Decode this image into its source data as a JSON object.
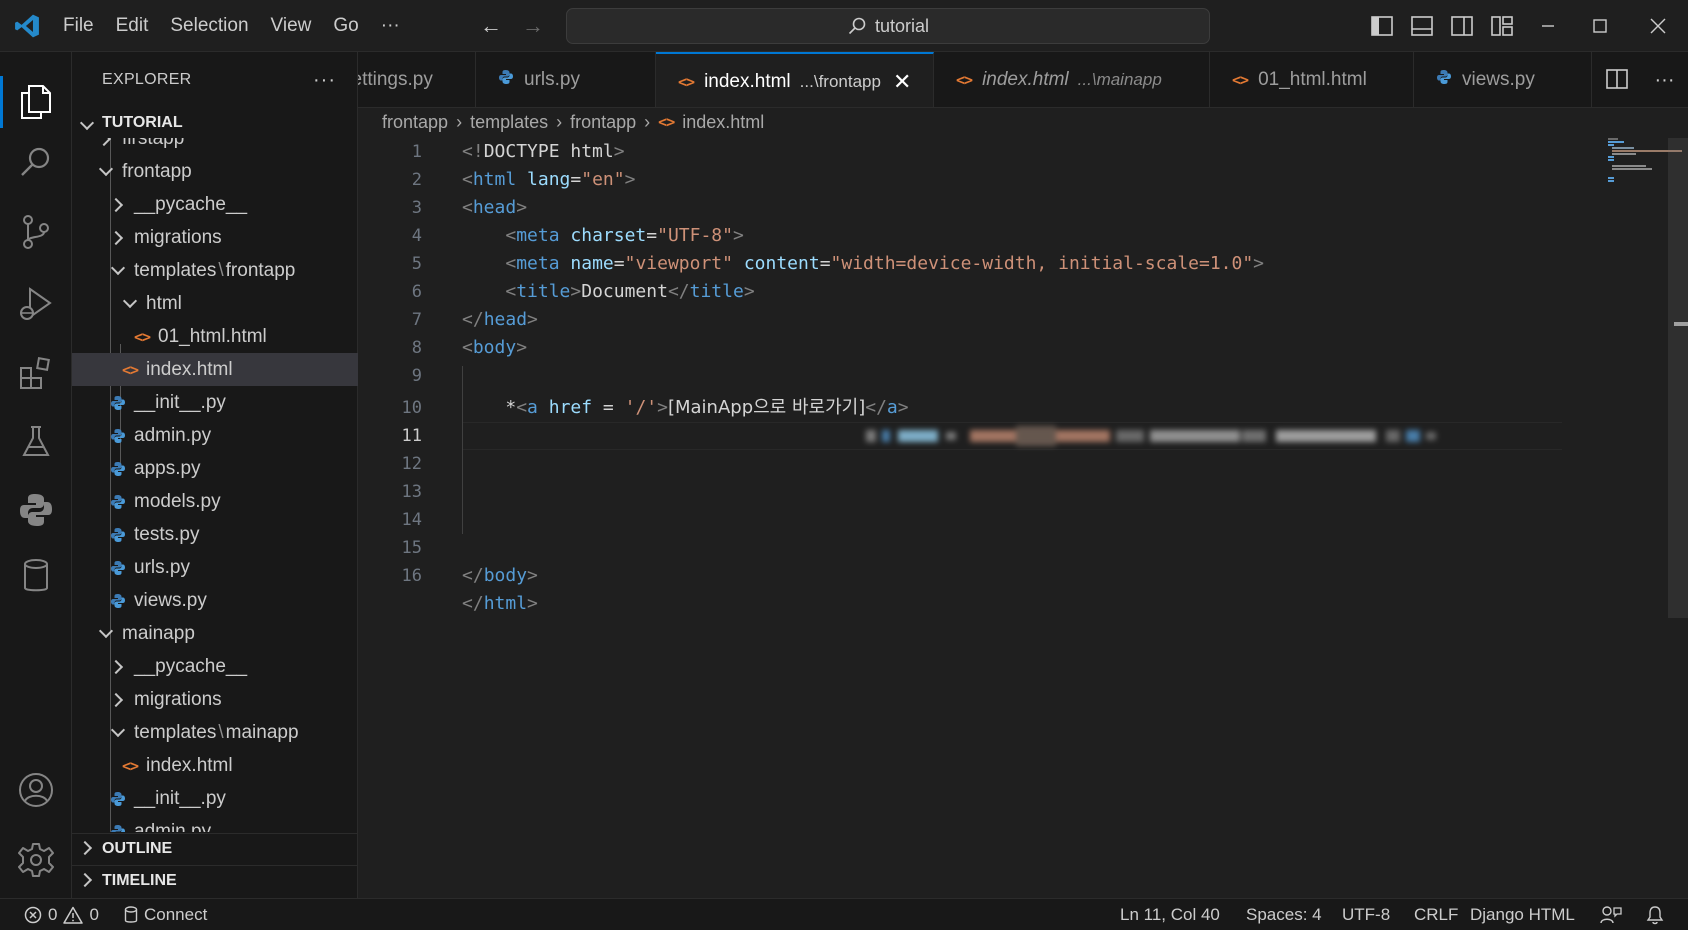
{
  "titlebar": {
    "menu": [
      "File",
      "Edit",
      "Selection",
      "View",
      "Go"
    ],
    "more": "···",
    "search": "tutorial"
  },
  "explorer": {
    "title": "EXPLORER",
    "more": "···",
    "root": "TUTORIAL",
    "tree": {
      "partial_top": "firstapp",
      "frontapp": "frontapp",
      "pycache1": "__pycache__",
      "migrations1": "migrations",
      "templates1": "templates",
      "templates1_sub": "frontapp",
      "html_folder": "html",
      "file_01html": "01_html.html",
      "index1": "index.html",
      "init1": "__init__.py",
      "admin": "admin.py",
      "apps": "apps.py",
      "models": "models.py",
      "tests": "tests.py",
      "urls": "urls.py",
      "views": "views.py",
      "mainapp": "mainapp",
      "pycache2": "__pycache__",
      "migrations2": "migrations",
      "templates2": "templates",
      "templates2_sub": "mainapp",
      "index2": "index.html",
      "init2": "__init__.py",
      "admin2_partial": "admin.py"
    },
    "outline": "OUTLINE",
    "timeline": "TIMELINE"
  },
  "tabs": [
    {
      "label": "settings.py",
      "desc": ""
    },
    {
      "label": "urls.py",
      "desc": ""
    },
    {
      "label": "index.html",
      "desc": "...\\frontapp"
    },
    {
      "label": "index.html",
      "desc": "...\\mainapp"
    },
    {
      "label": "01_html.html",
      "desc": ""
    },
    {
      "label": "views.py",
      "desc": ""
    }
  ],
  "breadcrumbs": [
    "frontapp",
    "templates",
    "frontapp",
    "index.html"
  ],
  "editor": {
    "line_numbers": [
      "1",
      "2",
      "3",
      "4",
      "5",
      "6",
      "7",
      "8",
      "9",
      "10",
      "11",
      "12",
      "13",
      "14",
      "15",
      "16"
    ],
    "current_line": 11,
    "lines": {
      "l1": {
        "open": "<!",
        "name": "DOCTYPE html",
        "close": ">"
      },
      "l2": {
        "tag": "html",
        "attr": "lang",
        "val": "\"en\""
      },
      "l3": {
        "tag": "head"
      },
      "l4": {
        "tag": "meta",
        "attr": "charset",
        "val": "\"UTF-8\""
      },
      "l5": {
        "tag": "meta",
        "attr1": "name",
        "val1": "\"viewport\"",
        "attr2": "content",
        "val2": "\"width=device-width, initial-scale=1.0\""
      },
      "l6": {
        "tag": "title",
        "text": "Document"
      },
      "l7": {
        "tag": "head"
      },
      "l8": {
        "tag": "body"
      },
      "l10": {
        "prefix": "*",
        "tag": "a",
        "attr": "href",
        "eq": " = ",
        "val": "'/'",
        "text": "[MainApp으로 바로가기]"
      },
      "l15": {
        "tag": "body"
      },
      "l16": {
        "tag": "html"
      }
    }
  },
  "statusbar": {
    "errors": "0",
    "warnings": "0",
    "connect": "Connect",
    "position": "Ln 11, Col 40",
    "spaces": "Spaces: 4",
    "encoding": "UTF-8",
    "eol": "CRLF",
    "language": "Django HTML"
  },
  "colors": {
    "accent": "#0078d4",
    "html_icon": "#e37933",
    "python_icon": "#3c7bb5"
  }
}
